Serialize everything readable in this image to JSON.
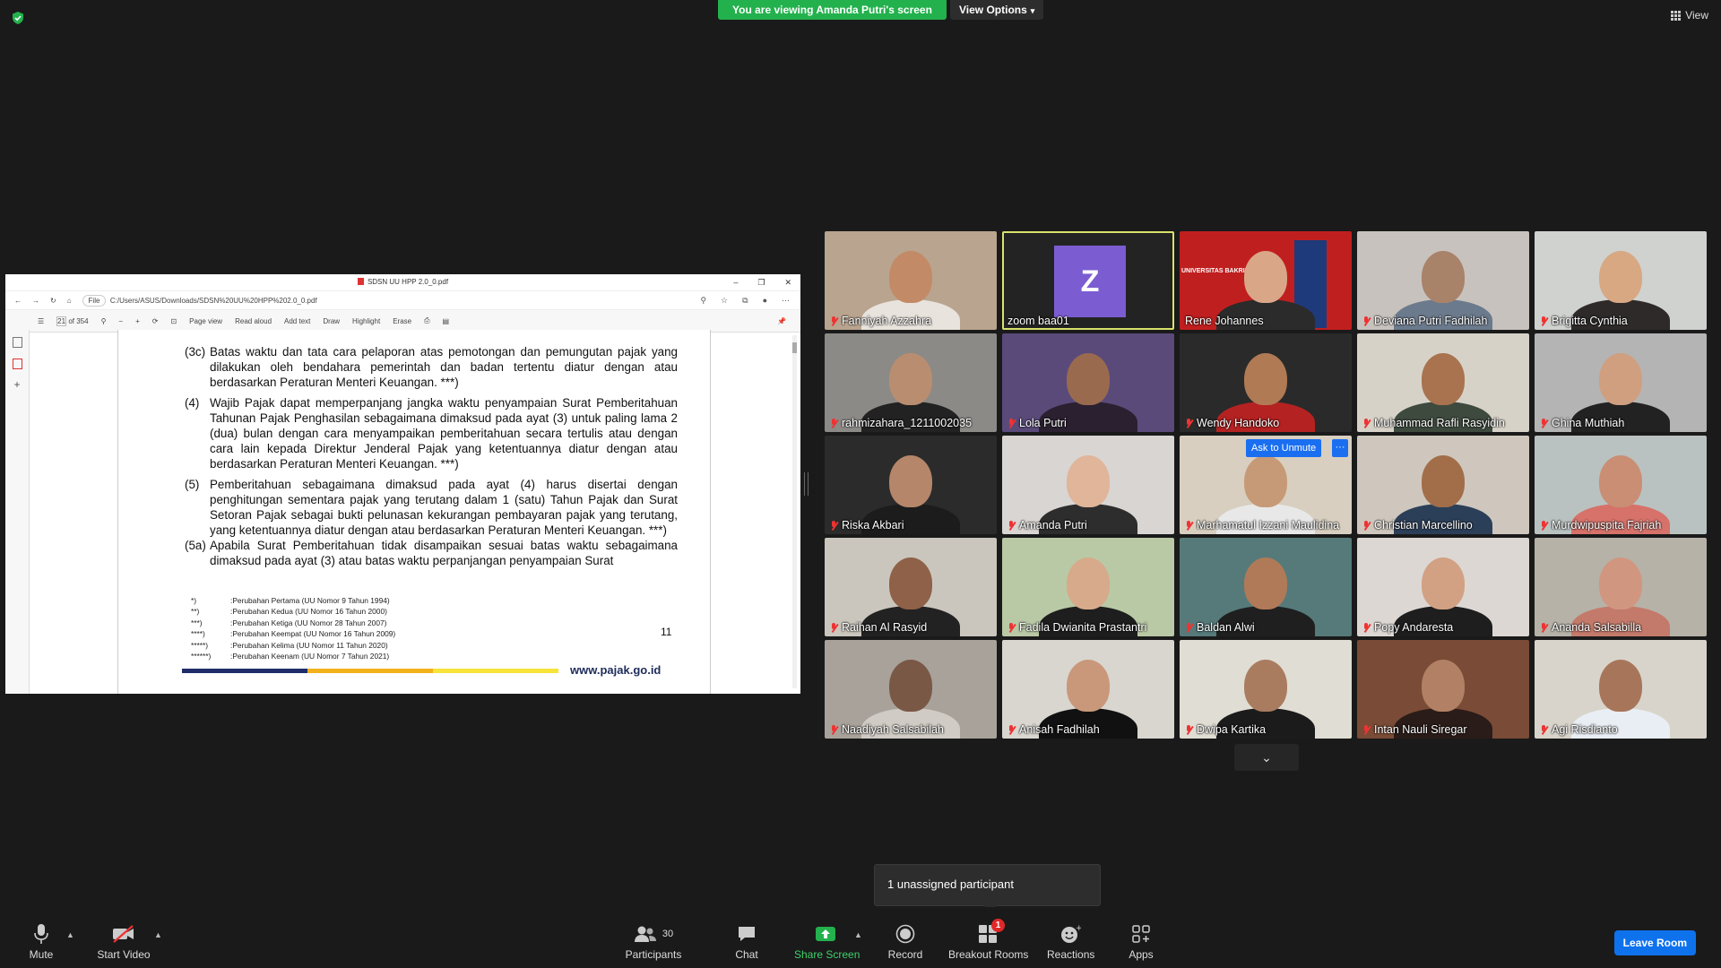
{
  "banner": {
    "sharing_text": "You are viewing Amanda Putri's screen",
    "view_options": "View Options"
  },
  "top_right": {
    "view_label": "View"
  },
  "pdf": {
    "title": "SDSN UU HPP 2.0_0.pdf",
    "url_prefix": "File",
    "url": "C:/Users/ASUS/Downloads/SDSN%20UU%20HPP%202.0_0.pdf",
    "page_current": "21",
    "page_total": "of 354",
    "tools": [
      "Page view",
      "Read aloud",
      "Add text",
      "Draw",
      "Highlight",
      "Erase"
    ],
    "paragraphs": [
      {
        "num": "(3c)",
        "text": "Batas waktu dan tata cara pelaporan atas pemotongan dan pemungutan pajak yang dilakukan oleh bendahara pemerintah dan badan tertentu diatur dengan atau berdasarkan Peraturan Menteri Keuangan. ***)"
      },
      {
        "num": "(4)",
        "text": "Wajib Pajak dapat memperpanjang jangka waktu penyampaian Surat Pemberitahuan Tahunan Pajak Penghasilan sebagaimana dimaksud pada ayat (3) untuk paling lama 2 (dua) bulan dengan cara menyampaikan pemberitahuan secara tertulis atau dengan cara lain kepada Direktur Jenderal Pajak yang ketentuannya diatur dengan atau berdasarkan Peraturan Menteri Keuangan. ***)"
      },
      {
        "num": "(5)",
        "text": "Pemberitahuan sebagaimana dimaksud pada ayat (4) harus disertai dengan penghitungan sementara pajak yang terutang dalam 1 (satu) Tahun Pajak dan Surat Setoran Pajak sebagai bukti pelunasan kekurangan pembayaran pajak yang terutang, yang ketentuannya diatur dengan atau berdasarkan Peraturan Menteri Keuangan. ***)"
      },
      {
        "num": "(5a)",
        "text": "Apabila Surat Pemberitahuan tidak disampaikan sesuai batas waktu sebagaimana dimaksud pada ayat (3) atau batas waktu perpanjangan penyampaian Surat"
      }
    ],
    "footnotes": [
      {
        "k": "*)",
        "v": ":Perubahan Pertama (UU Nomor 9 Tahun 1994)"
      },
      {
        "k": "**)",
        "v": ":Perubahan Kedua (UU Nomor 16 Tahun 2000)"
      },
      {
        "k": "***)",
        "v": ":Perubahan Ketiga (UU Nomor 28 Tahun 2007)"
      },
      {
        "k": "****)",
        "v": ":Perubahan Keempat (UU Nomor 16 Tahun 2009)"
      },
      {
        "k": "*****)",
        "v": ":Perubahan Kelima (UU Nomor 11 Tahun 2020)"
      },
      {
        "k": "******)",
        "v": ":Perubahan Keenam (UU Nomor 7 Tahun 2021)"
      }
    ],
    "page_number": "11",
    "website": "www.pajak.go.id"
  },
  "participants": [
    {
      "name": "Fanniyah Azzahra",
      "bg": "#b9a48f",
      "skin": "#c28a66",
      "cloth": "#e8e3dc",
      "muted": true
    },
    {
      "name": "zoom baa01",
      "bg": "#232323",
      "muted": false,
      "avatar_letter": "Z"
    },
    {
      "name": "Rene Johannes",
      "bg": "#c01f1f",
      "skin": "#d9a788",
      "cloth": "#2b2b2b",
      "muted": false,
      "logo_text": "UNIVERSITAS BAKRIE"
    },
    {
      "name": "Deviana Putri Fadhilah",
      "bg": "#c7c2bd",
      "skin": "#a9826a",
      "cloth": "#6b7a8c",
      "muted": true
    },
    {
      "name": "Brigitta Cynthia",
      "bg": "#cfd2cf",
      "skin": "#d8a883",
      "cloth": "#2e2a2a",
      "muted": true
    },
    {
      "name": "rahmizahara_1211002035",
      "bg": "#8c8a86",
      "skin": "#b98e70",
      "cloth": "#222",
      "muted": true
    },
    {
      "name": "Lola Putri",
      "bg": "#5a4a7a",
      "skin": "#9a6a4f",
      "cloth": "#2a2030",
      "muted": true
    },
    {
      "name": "Wendy Handoko",
      "bg": "#2a2a2a",
      "skin": "#b07a55",
      "cloth": "#b52222",
      "muted": true
    },
    {
      "name": "Muhammad Rafli Rasyidin",
      "bg": "#d7d2c8",
      "skin": "#a8734e",
      "cloth": "#3e4a3e",
      "muted": true
    },
    {
      "name": "Ghina Muthiah",
      "bg": "#b4b4b4",
      "skin": "#d09f80",
      "cloth": "#222",
      "muted": true
    },
    {
      "name": "Riska Akbari",
      "bg": "#2b2b2b",
      "skin": "#b5866a",
      "cloth": "#1c1c1c",
      "muted": true
    },
    {
      "name": "Amanda Putri",
      "bg": "#d9d5d2",
      "skin": "#e0b59a",
      "cloth": "#2d2d2d",
      "muted": true
    },
    {
      "name": "Marhamatul Izzani Maulidina",
      "bg": "#d8cfc0",
      "skin": "#c79a77",
      "cloth": "#e8e8e8",
      "muted": true,
      "unmute_label": "Ask to Unmute",
      "more_label": "···"
    },
    {
      "name": "Christian Marcellino",
      "bg": "#cfc7bd",
      "skin": "#a26e4a",
      "cloth": "#2c3f59",
      "muted": true
    },
    {
      "name": "Murdwipuspita Fajriah",
      "bg": "#b9c2c0",
      "skin": "#c98e74",
      "cloth": "#d6726a",
      "muted": true
    },
    {
      "name": "Raihan Al Rasyid",
      "bg": "#cac6bd",
      "skin": "#8e6148",
      "cloth": "#222",
      "muted": true
    },
    {
      "name": "Fadila Dwianita Prastantri",
      "bg": "#b9c9a5",
      "skin": "#d6aa8a",
      "cloth": "#1e1e1e",
      "muted": true
    },
    {
      "name": "Baldan Alwi",
      "bg": "#567a7a",
      "skin": "#b07a58",
      "cloth": "#1f1f1f",
      "muted": true
    },
    {
      "name": "Popy Andaresta",
      "bg": "#ddd7d3",
      "skin": "#d2a183",
      "cloth": "#1e1e1e",
      "muted": true
    },
    {
      "name": "Ananda Salsabilla",
      "bg": "#b6b2a8",
      "skin": "#d19680",
      "cloth": "#c47a6a",
      "muted": true
    },
    {
      "name": "Naadiyah Salsabilah",
      "bg": "#a8a29a",
      "skin": "#7a5846",
      "cloth": "#d0cbc4",
      "muted": true
    },
    {
      "name": "Anisah Fadhilah",
      "bg": "#d9d6d0",
      "skin": "#c9987a",
      "cloth": "#111",
      "muted": true
    },
    {
      "name": "Dwipa Kartika",
      "bg": "#e0ddd4",
      "skin": "#a97c60",
      "cloth": "#1b1b1b",
      "muted": true
    },
    {
      "name": "Intan Nauli Siregar",
      "bg": "#7a4b36",
      "skin": "#b28064",
      "cloth": "#2a1c18",
      "muted": true
    },
    {
      "name": "Agi Risdianto",
      "bg": "#d8d4cc",
      "skin": "#a7765a",
      "cloth": "#e9eef4",
      "muted": true
    }
  ],
  "tooltip": {
    "text": "1 unassigned participant"
  },
  "toolbar": {
    "mute": "Mute",
    "start_video": "Start Video",
    "participants": "Participants",
    "participants_count": "30",
    "chat": "Chat",
    "share_screen": "Share Screen",
    "record": "Record",
    "breakout_rooms": "Breakout Rooms",
    "breakout_badge": "1",
    "reactions": "Reactions",
    "apps": "Apps",
    "leave": "Leave Room"
  }
}
